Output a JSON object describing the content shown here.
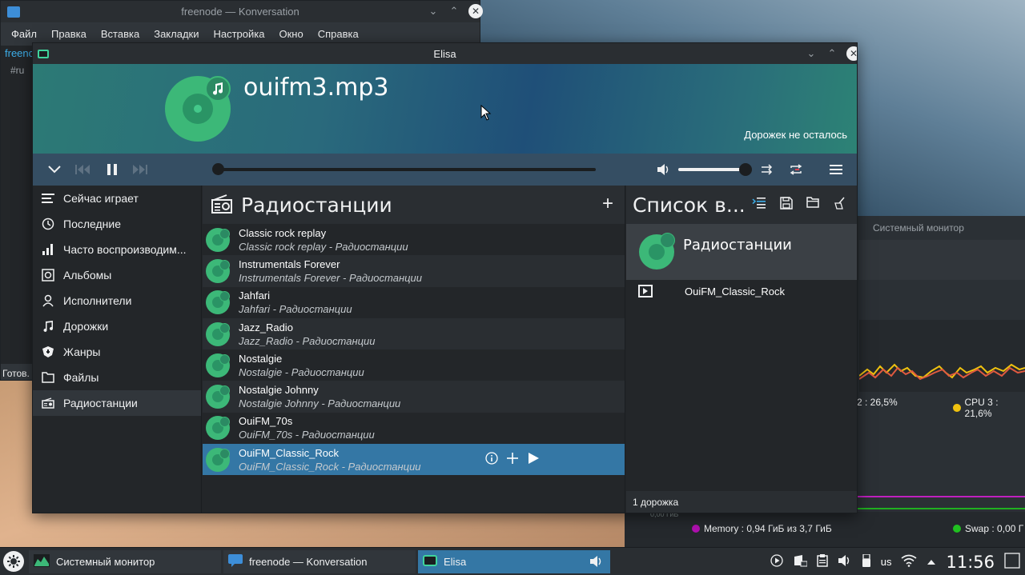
{
  "konversation": {
    "title": "freenode — Konversation",
    "menu": [
      "Файл",
      "Правка",
      "Вставка",
      "Закладки",
      "Настройка",
      "Окно",
      "Справка"
    ],
    "tab": "freenc",
    "channel": "#ru",
    "status": "Готов."
  },
  "sysmon": {
    "tab_label": "Системный монитор",
    "cpu2": "2 : 26,5%",
    "cpu3": "CPU 3 : 21,6%",
    "memory": "Memory : 0,94 ГиБ из 3,7 ГиБ",
    "swap": "Swap : 0,00 Г",
    "tick": "0,00 ГиБ",
    "colors": {
      "cpu3": "#f0c20f",
      "memory": "#b010b0",
      "swap": "#20c020"
    }
  },
  "elisa": {
    "title": "Elisa",
    "now_playing": {
      "title": "ouifm3.mp3",
      "remaining": "Дорожек не осталось"
    },
    "playback": {
      "state": "playing",
      "position": 0,
      "volume": 0.9
    },
    "sidebar": [
      {
        "label": "Сейчас играет",
        "icon": "list-icon"
      },
      {
        "label": "Последние",
        "icon": "clock-icon"
      },
      {
        "label": "Часто воспроизводим...",
        "icon": "bars-icon"
      },
      {
        "label": "Альбомы",
        "icon": "album-icon"
      },
      {
        "label": "Исполнители",
        "icon": "user-icon"
      },
      {
        "label": "Дорожки",
        "icon": "note-icon"
      },
      {
        "label": "Жанры",
        "icon": "genre-icon"
      },
      {
        "label": "Файлы",
        "icon": "folder-icon"
      },
      {
        "label": "Радиостанции",
        "icon": "radio-icon",
        "active": true
      }
    ],
    "view": {
      "title": "Радиостанции",
      "items": [
        {
          "title": "Classic rock replay",
          "subtitle": "Classic rock replay - Радиостанции"
        },
        {
          "title": "Instrumentals Forever",
          "subtitle": "Instrumentals Forever - Радиостанции"
        },
        {
          "title": "Jahfari",
          "subtitle": "Jahfari - Радиостанции"
        },
        {
          "title": "Jazz_Radio",
          "subtitle": "Jazz_Radio - Радиостанции"
        },
        {
          "title": "Nostalgie",
          "subtitle": "Nostalgie - Радиостанции"
        },
        {
          "title": "Nostalgie Johnny",
          "subtitle": "Nostalgie Johnny - Радиостанции"
        },
        {
          "title": "OuiFM_70s",
          "subtitle": "OuiFM_70s - Радиостанции"
        },
        {
          "title": "OuiFM_Classic_Rock",
          "subtitle": "OuiFM_Classic_Rock - Радиостанции",
          "selected": true
        }
      ]
    },
    "playlist": {
      "title": "Список в...",
      "album_title": "Радиостанции",
      "tracks": [
        {
          "name": "OuiFM_Classic_Rock"
        }
      ],
      "footer": "1 дорожка"
    }
  },
  "taskbar": {
    "tasks": [
      {
        "label": "Системный монитор"
      },
      {
        "label": "freenode — Konversation"
      },
      {
        "label": "Elisa",
        "active": true
      }
    ],
    "lang": "us",
    "clock": "11:56"
  }
}
